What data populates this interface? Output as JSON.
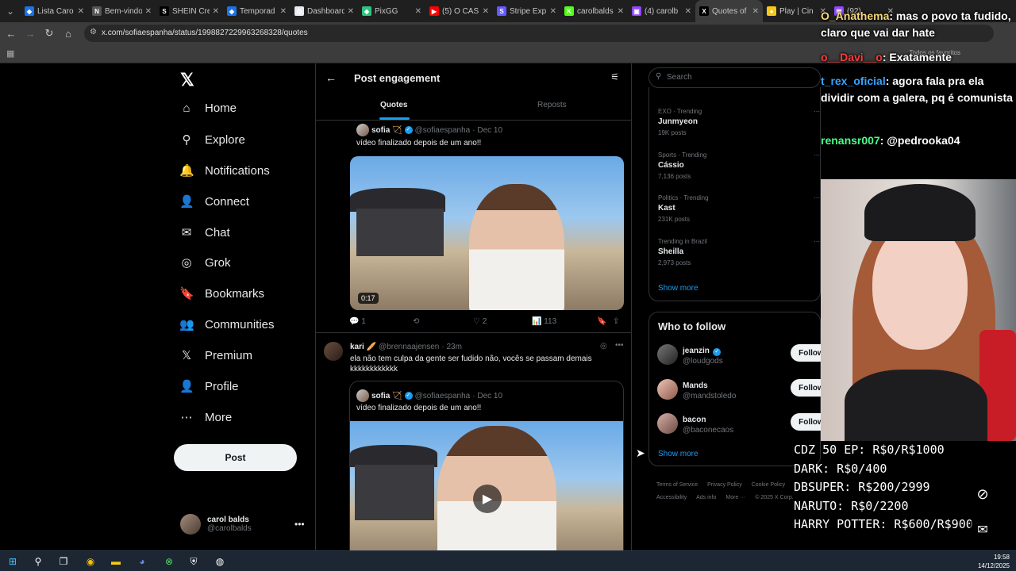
{
  "browser": {
    "tabs": [
      {
        "title": "Lista Caro",
        "color": "#1a73e8",
        "glyph": "◆"
      },
      {
        "title": "Bem-vindo",
        "color": "#555555",
        "glyph": "N"
      },
      {
        "title": "SHEIN Cre",
        "color": "#000000",
        "glyph": "S"
      },
      {
        "title": "Temporad",
        "color": "#1a73e8",
        "glyph": "◆"
      },
      {
        "title": "Dashboard",
        "color": "#e8eaed",
        "glyph": "◎"
      },
      {
        "title": "PixGG",
        "color": "#2ec27e",
        "glyph": "◆"
      },
      {
        "title": "(5) O CAS",
        "color": "#ff0000",
        "glyph": "▶"
      },
      {
        "title": "Stripe Exp",
        "color": "#635bff",
        "glyph": "S"
      },
      {
        "title": "carolbalds",
        "color": "#53fc18",
        "glyph": "K"
      },
      {
        "title": "(4) carolb",
        "color": "#9146ff",
        "glyph": "▣"
      },
      {
        "title": "Quotes of",
        "color": "#000000",
        "glyph": "X"
      },
      {
        "title": "Play | Cin",
        "color": "#f6c915",
        "glyph": "●"
      },
      {
        "title": "(92)",
        "color": "#9146ff",
        "glyph": "▣"
      }
    ],
    "url": "x.com/sofiaespanha/status/1998827229963268328/quotes",
    "bookmarks_label": "Todos os favoritos"
  },
  "sidebar": {
    "logo": "𝕏",
    "items": [
      {
        "label": "Home",
        "icon": "⌂"
      },
      {
        "label": "Explore",
        "icon": "⚲"
      },
      {
        "label": "Notifications",
        "icon": "🔔"
      },
      {
        "label": "Connect",
        "icon": "👤"
      },
      {
        "label": "Chat",
        "icon": "✉"
      },
      {
        "label": "Grok",
        "icon": "◎"
      },
      {
        "label": "Bookmarks",
        "icon": "🔖"
      },
      {
        "label": "Communities",
        "icon": "👥"
      },
      {
        "label": "Premium",
        "icon": "𝕏"
      },
      {
        "label": "Profile",
        "icon": "👤"
      },
      {
        "label": "More",
        "icon": "⋯"
      }
    ],
    "post_label": "Post",
    "account": {
      "name": "carol balds",
      "handle": "@carolbalds"
    }
  },
  "main": {
    "title": "Post engagement",
    "tabs": {
      "quotes": "Quotes",
      "reposts": "Reposts"
    },
    "quote1": {
      "name": "sofia 🏹",
      "handle": "@sofiaespanha",
      "date": "· Dec 10",
      "text": "vídeo finalizado depois de um ano!!",
      "duration": "0:17",
      "replies": "1",
      "likes": "2",
      "views": "113"
    },
    "quote2": {
      "name": "kari 🥖",
      "handle": "@brennaajensen",
      "date": "· 23m",
      "text": "ela não tem culpa da gente ser fudido não, vocês se passam demais kkkkkkkkkkkk",
      "inner_name": "sofia 🏹",
      "inner_handle": "@sofiaespanha",
      "inner_date": "· Dec 10",
      "inner_text": "vídeo finalizado depois de um ano!!"
    }
  },
  "right": {
    "search_placeholder": "Search",
    "trends": [
      {
        "context": "EXO · Trending",
        "topic": "Junmyeon",
        "posts": "19K posts"
      },
      {
        "context": "Sports · Trending",
        "topic": "Cássio",
        "posts": "7,136 posts"
      },
      {
        "context": "Politics · Trending",
        "topic": "Kast",
        "posts": "231K posts"
      },
      {
        "context": "Trending in Brazil",
        "topic": "Sheilla",
        "posts": "2,973 posts"
      }
    ],
    "show_more": "Show more",
    "who_to_follow": "Who to follow",
    "follow_label": "Follow",
    "suggestions": [
      {
        "name": "jeanzin",
        "handle": "@loudgods",
        "verified": true
      },
      {
        "name": "Mands",
        "handle": "@mandstoledo",
        "verified": false
      },
      {
        "name": "bacon",
        "handle": "@baconecaos",
        "verified": false
      }
    ],
    "footer": [
      "Terms of Service",
      "Privacy Policy",
      "Cookie Policy",
      "Accessibility",
      "Ads info",
      "More ···",
      "© 2025 X Corp."
    ]
  },
  "stream": {
    "chat": [
      {
        "user": "O_Anathema",
        "color": "#f6d77a",
        "msg": ": mas o povo ta fudido, claro que vai dar hate"
      },
      {
        "user": "o__Davi__o",
        "color": "#ff3b3b",
        "msg": ": Exatamente"
      },
      {
        "user": "t_rex_oficial",
        "color": "#37a3ff",
        "msg": ": agora fala pra ela dividir com a galera, pq é comunista"
      },
      {
        "user": "renansr007",
        "color": "#4cff88",
        "msg": ": @pedrooka04"
      }
    ],
    "goals": [
      "CDZ 50 EP: R$0/R$1000",
      "DARK: R$0/400",
      "DBSUPER: R$200/2999",
      "NARUTO: R$0/2200",
      "HARRY POTTER: R$600/R$900"
    ]
  },
  "taskbar": {
    "time": "19:58",
    "date": "14/12/2025"
  }
}
